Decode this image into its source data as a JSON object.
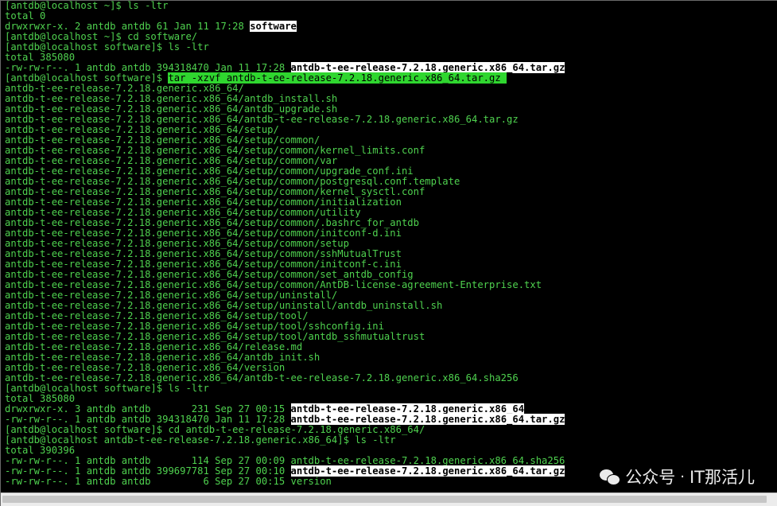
{
  "terminal": {
    "lines": [
      [
        {
          "t": "[antdb@localhost ~]$ ls -ltr"
        }
      ],
      [
        {
          "t": "total 0"
        }
      ],
      [
        {
          "t": "drwxrwxr-x. 2 antdb antdb 61 Jan 11 17:28 "
        },
        {
          "t": "software",
          "s": "white"
        }
      ],
      [
        {
          "t": "[antdb@localhost ~]$ cd software/"
        }
      ],
      [
        {
          "t": "[antdb@localhost software]$ ls -ltr"
        }
      ],
      [
        {
          "t": "total 385080"
        }
      ],
      [
        {
          "t": "-rw-rw-r--. 1 antdb antdb 394318470 Jan 11 17:28 "
        },
        {
          "t": "antdb-t-ee-release-7.2.18.generic.x86_64.tar.gz",
          "s": "white"
        }
      ],
      [
        {
          "t": "[antdb@localhost software]$ "
        },
        {
          "t": "tar -xzvf antdb-t-ee-release-7.2.18.generic.x86_64.tar.gz ",
          "s": "green"
        }
      ],
      [
        {
          "t": "antdb-t-ee-release-7.2.18.generic.x86_64/"
        }
      ],
      [
        {
          "t": "antdb-t-ee-release-7.2.18.generic.x86_64/antdb_install.sh"
        }
      ],
      [
        {
          "t": "antdb-t-ee-release-7.2.18.generic.x86_64/antdb_upgrade.sh"
        }
      ],
      [
        {
          "t": "antdb-t-ee-release-7.2.18.generic.x86_64/antdb-t-ee-release-7.2.18.generic.x86_64.tar.gz"
        }
      ],
      [
        {
          "t": "antdb-t-ee-release-7.2.18.generic.x86_64/setup/"
        }
      ],
      [
        {
          "t": "antdb-t-ee-release-7.2.18.generic.x86_64/setup/common/"
        }
      ],
      [
        {
          "t": "antdb-t-ee-release-7.2.18.generic.x86_64/setup/common/kernel_limits.conf"
        }
      ],
      [
        {
          "t": "antdb-t-ee-release-7.2.18.generic.x86_64/setup/common/var"
        }
      ],
      [
        {
          "t": "antdb-t-ee-release-7.2.18.generic.x86_64/setup/common/upgrade_conf.ini"
        }
      ],
      [
        {
          "t": "antdb-t-ee-release-7.2.18.generic.x86_64/setup/common/postgresql.conf.template"
        }
      ],
      [
        {
          "t": "antdb-t-ee-release-7.2.18.generic.x86_64/setup/common/kernel_sysctl.conf"
        }
      ],
      [
        {
          "t": "antdb-t-ee-release-7.2.18.generic.x86_64/setup/common/initialization"
        }
      ],
      [
        {
          "t": "antdb-t-ee-release-7.2.18.generic.x86_64/setup/common/utility"
        }
      ],
      [
        {
          "t": "antdb-t-ee-release-7.2.18.generic.x86_64/setup/common/.bashrc_for_antdb"
        }
      ],
      [
        {
          "t": "antdb-t-ee-release-7.2.18.generic.x86_64/setup/common/initconf-d.ini"
        }
      ],
      [
        {
          "t": "antdb-t-ee-release-7.2.18.generic.x86_64/setup/common/setup"
        }
      ],
      [
        {
          "t": "antdb-t-ee-release-7.2.18.generic.x86_64/setup/common/sshMutualTrust"
        }
      ],
      [
        {
          "t": "antdb-t-ee-release-7.2.18.generic.x86_64/setup/common/initconf-c.ini"
        }
      ],
      [
        {
          "t": "antdb-t-ee-release-7.2.18.generic.x86_64/setup/common/set_antdb_config"
        }
      ],
      [
        {
          "t": "antdb-t-ee-release-7.2.18.generic.x86_64/setup/common/AntDB-license-agreement-Enterprise.txt"
        }
      ],
      [
        {
          "t": "antdb-t-ee-release-7.2.18.generic.x86_64/setup/uninstall/"
        }
      ],
      [
        {
          "t": "antdb-t-ee-release-7.2.18.generic.x86_64/setup/uninstall/antdb_uninstall.sh"
        }
      ],
      [
        {
          "t": "antdb-t-ee-release-7.2.18.generic.x86_64/setup/tool/"
        }
      ],
      [
        {
          "t": "antdb-t-ee-release-7.2.18.generic.x86_64/setup/tool/sshconfig.ini"
        }
      ],
      [
        {
          "t": "antdb-t-ee-release-7.2.18.generic.x86_64/setup/tool/antdb_sshmutualtrust"
        }
      ],
      [
        {
          "t": "antdb-t-ee-release-7.2.18.generic.x86_64/release.md"
        }
      ],
      [
        {
          "t": "antdb-t-ee-release-7.2.18.generic.x86_64/antdb_init.sh"
        }
      ],
      [
        {
          "t": "antdb-t-ee-release-7.2.18.generic.x86_64/version"
        }
      ],
      [
        {
          "t": "antdb-t-ee-release-7.2.18.generic.x86_64/antdb-t-ee-release-7.2.18.generic.x86_64.sha256"
        }
      ],
      [
        {
          "t": "[antdb@localhost software]$ ls -ltr"
        }
      ],
      [
        {
          "t": "total 385080"
        }
      ],
      [
        {
          "t": "drwxrwxr-x. 3 antdb antdb       231 Sep 27 00:15 "
        },
        {
          "t": "antdb-t-ee-release-7.2.18.generic.x86_64",
          "s": "white"
        }
      ],
      [
        {
          "t": "-rw-rw-r--. 1 antdb antdb 394318470 Jan 11 17:28 "
        },
        {
          "t": "antdb-t-ee-release-7.2.18.generic.x86_64.tar.gz",
          "s": "white"
        }
      ],
      [
        {
          "t": "[antdb@localhost software]$ cd antdb-t-ee-release-7.2.18.generic.x86_64/"
        }
      ],
      [
        {
          "t": "[antdb@localhost antdb-t-ee-release-7.2.18.generic.x86_64]$ ls -ltr"
        }
      ],
      [
        {
          "t": "total 390396"
        }
      ],
      [
        {
          "t": "-rw-rw-r--. 1 antdb antdb       114 Sep 27 00:09 antdb-t-ee-release-7.2.18.generic.x86_64.sha256"
        }
      ],
      [
        {
          "t": "-rw-rw-r--. 1 antdb antdb 399697781 Sep 27 00:10 "
        },
        {
          "t": "antdb-t-ee-release-7.2.18.generic.x86_64.tar.gz",
          "s": "white"
        }
      ],
      [
        {
          "t": "-rw-rw-r--. 1 antdb antdb         6 Sep 27 00:15 version"
        }
      ]
    ]
  },
  "watermark": {
    "icon": "wechat-icon",
    "account_label": "公众号",
    "separator": "·",
    "account_name": "IT那活儿"
  },
  "colors": {
    "background": "#000000",
    "text": "#4fd24f",
    "highlight_white": "#ffffff",
    "highlight_green": "#2fd62f"
  }
}
